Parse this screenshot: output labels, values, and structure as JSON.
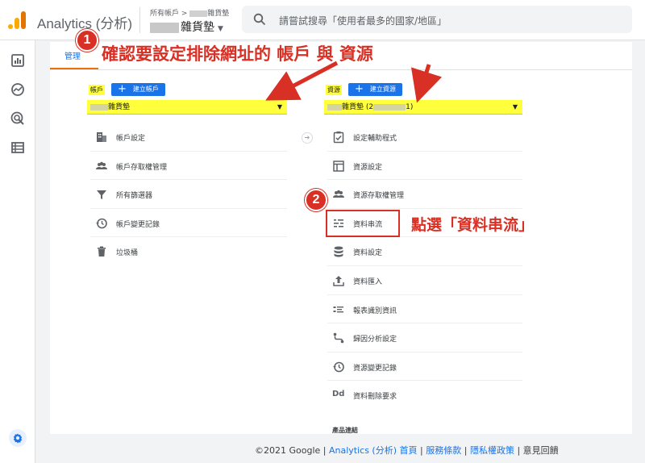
{
  "header": {
    "app_title": "Analytics (分析)",
    "breadcrumb_top": "所有帳戶 >",
    "breadcrumb_top_suffix": "雜貨墊",
    "breadcrumb_main": "雜貨墊",
    "search_placeholder": "請嘗試搜尋「使用者最多的國家/地區」"
  },
  "tabs": {
    "admin": "管理"
  },
  "account_column": {
    "label": "帳戶",
    "create_label": "建立帳戶",
    "selected": "雜貨墊",
    "items": [
      {
        "label": "帳戶設定",
        "icon": "building-icon"
      },
      {
        "label": "帳戶存取權管理",
        "icon": "people-icon"
      },
      {
        "label": "所有篩選器",
        "icon": "filter-icon"
      },
      {
        "label": "帳戶變更記錄",
        "icon": "history-icon"
      },
      {
        "label": "垃圾桶",
        "icon": "trash-icon"
      }
    ]
  },
  "property_column": {
    "label": "資源",
    "create_label": "建立資源",
    "selected_prefix": "雜貨墊 (2",
    "selected_suffix": "1)",
    "items": [
      {
        "label": "設定輔助程式",
        "icon": "clipboard-check-icon"
      },
      {
        "label": "資源設定",
        "icon": "layout-icon"
      },
      {
        "label": "資源存取權管理",
        "icon": "people-icon"
      },
      {
        "label": "資料串流",
        "icon": "stream-icon"
      },
      {
        "label": "資料設定",
        "icon": "database-icon"
      },
      {
        "label": "資料匯入",
        "icon": "upload-icon"
      },
      {
        "label": "報表識別資訊",
        "icon": "reporting-id-icon"
      },
      {
        "label": "歸因分析設定",
        "icon": "attribution-icon"
      },
      {
        "label": "資源變更記錄",
        "icon": "history-icon"
      },
      {
        "label": "資料刪除要求",
        "icon": "dd-icon"
      }
    ],
    "section_title": "產品連結",
    "dd_glyph": "Dd"
  },
  "annotations": {
    "badge1": "1",
    "text1": "確認要設定排除網址的 帳戶 與 資源",
    "badge2": "2",
    "text2": "點選「資料串流」"
  },
  "footer": {
    "copyright": "©2021 Google |",
    "link1": "Analytics (分析) 首頁",
    "sep1": "|",
    "link2": "服務條款",
    "sep2": "|",
    "link3": "隱私權政策",
    "sep3": "|",
    "feedback": "意見回饋"
  },
  "colors": {
    "accent": "#1a73e8",
    "highlight": "#ffff3b",
    "annotation": "#d93025",
    "tab_underline": "#e8710a"
  }
}
